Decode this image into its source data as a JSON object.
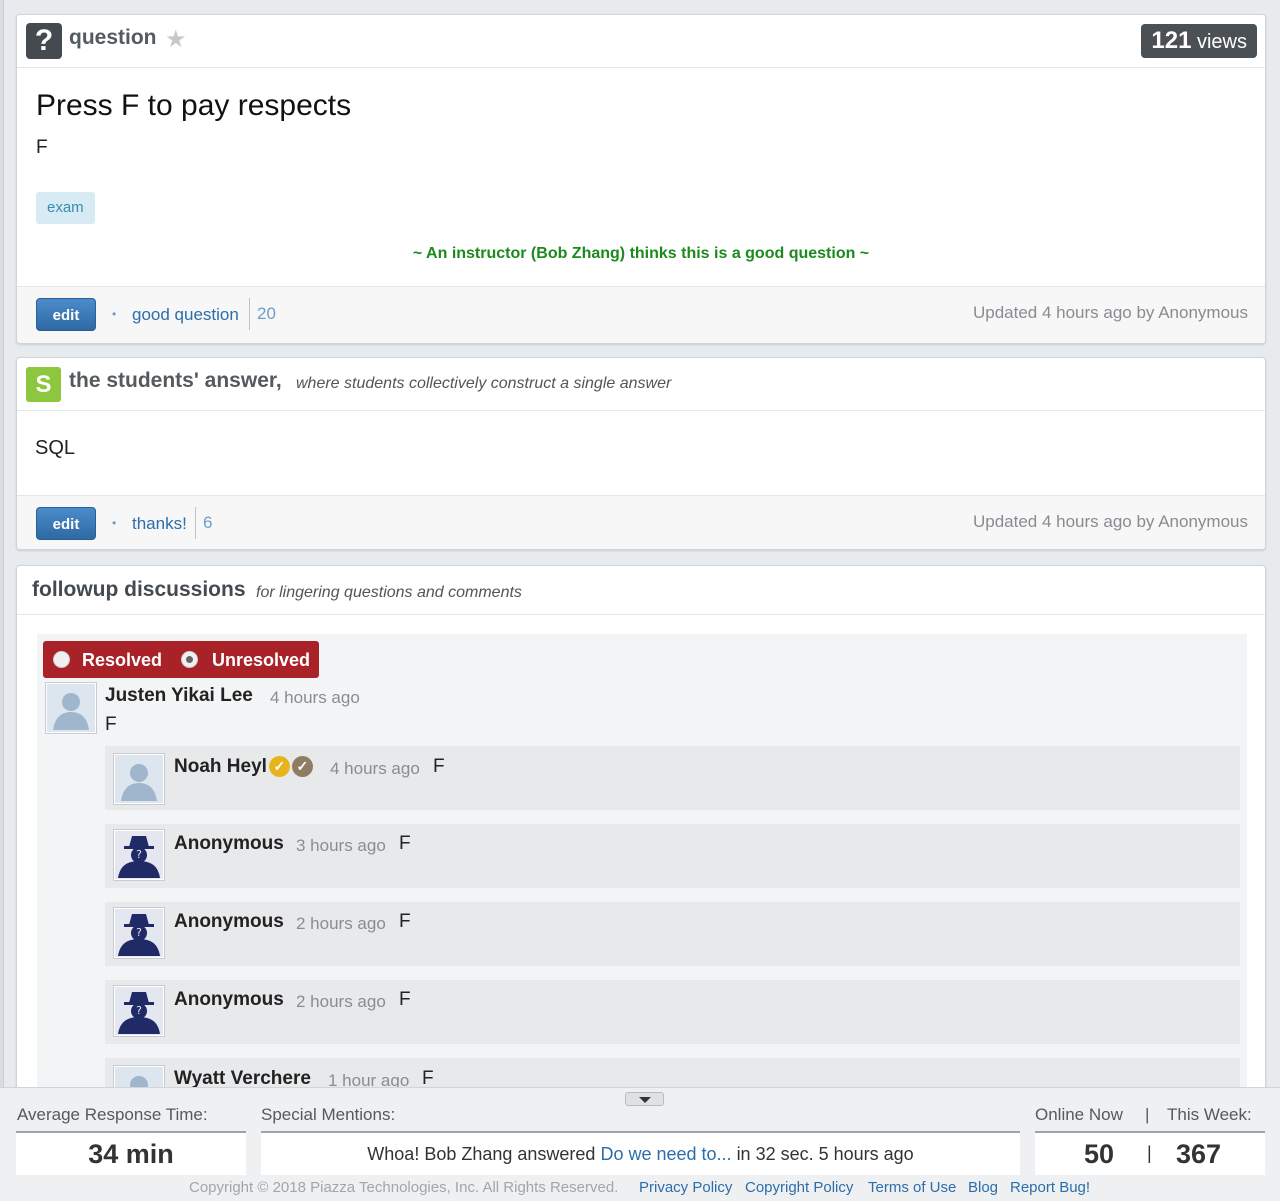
{
  "question": {
    "header_label": "question",
    "views_count": "121",
    "views_label": "views",
    "title": "Press F to pay respects",
    "body": "F",
    "tag": "exam",
    "endorsement": "~ An instructor (Bob Zhang) thinks this is a good question  ~",
    "edit_label": "edit",
    "good_label": "good question",
    "good_count": "20",
    "updated": "Updated 4 hours ago by Anonymous"
  },
  "students_answer": {
    "badge": "S",
    "title": "the students' answer,",
    "subtitle": "where students collectively construct a single answer",
    "body": "SQL",
    "edit_label": "edit",
    "thanks_label": "thanks!",
    "thanks_count": "6",
    "updated": "Updated 4 hours ago by Anonymous"
  },
  "followup": {
    "title": "followup discussions",
    "subtitle": "for lingering questions and comments",
    "resolved_label": "Resolved",
    "unresolved_label": "Unresolved",
    "thread": {
      "author": "Justen Yikai Lee",
      "time": "4 hours ago",
      "text": "F"
    },
    "replies": [
      {
        "author": "Noah Heyl",
        "time": "4 hours ago",
        "text": "F"
      },
      {
        "author": "Anonymous",
        "time": "3 hours ago",
        "text": "F"
      },
      {
        "author": "Anonymous",
        "time": "2 hours ago",
        "text": "F"
      },
      {
        "author": "Anonymous",
        "time": "2 hours ago",
        "text": "F"
      },
      {
        "author": "Wyatt Verchere",
        "time": "1 hour ago",
        "text": "F"
      }
    ]
  },
  "stats": {
    "avg_label": "Average Response Time:",
    "avg_value": "34 min",
    "mentions_label": "Special Mentions:",
    "mention_pre": "Whoa! Bob Zhang answered",
    "mention_link": "Do we need to...",
    "mention_post": "in 32 sec. 5 hours ago",
    "online_label": "Online Now",
    "sep": "|",
    "week_label": "This Week:",
    "online_value": "50",
    "week_value": "367"
  },
  "footer": {
    "copyright": "Copyright © 2018 Piazza Technologies, Inc. All Rights Reserved.",
    "privacy": "Privacy Policy",
    "copyright_policy": "Copyright Policy",
    "terms": "Terms of Use",
    "blog": "Blog",
    "report": "Report Bug!"
  },
  "colors": {
    "resolve_bg": "#a82228",
    "edit_btn": "#3d7ab6",
    "endorse_green": "#1d8a1d",
    "students_badge": "#8dc63f",
    "link_blue": "#2b6eaa"
  }
}
